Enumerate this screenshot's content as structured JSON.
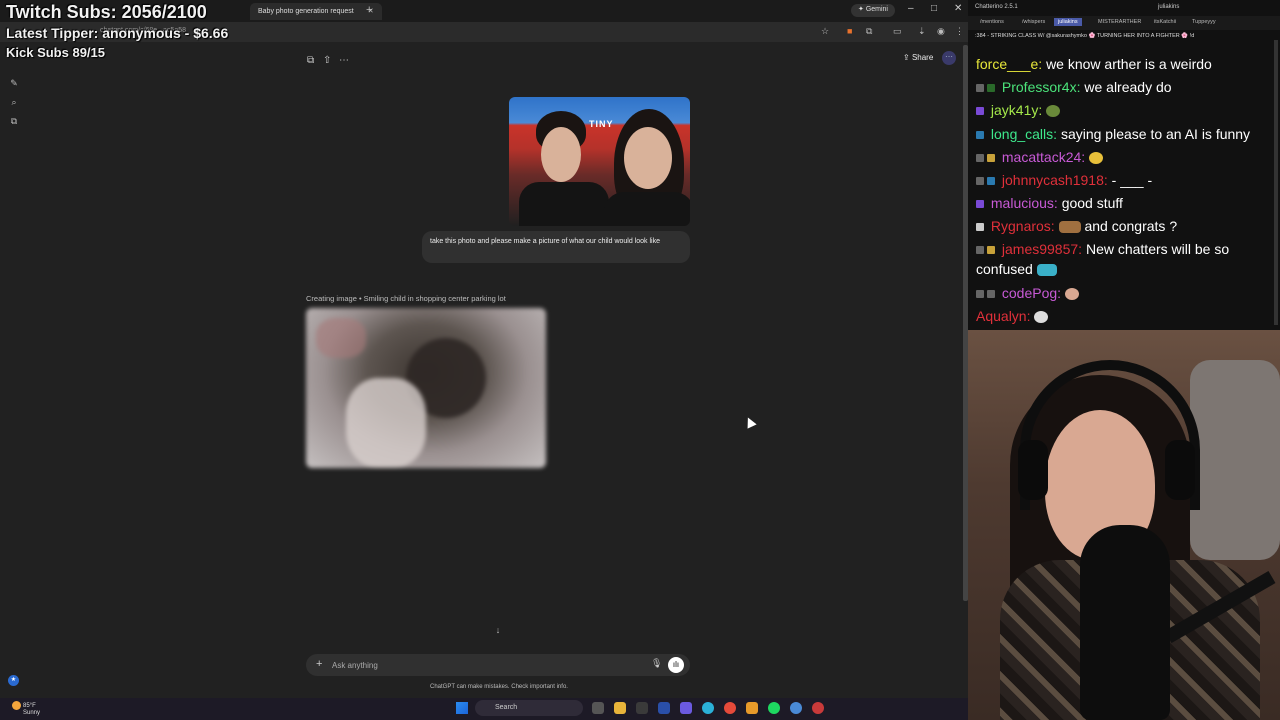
{
  "browser": {
    "tabs": [
      {
        "label": "Baby photo generation request",
        "active": true
      }
    ],
    "gemini_label": "Gemini",
    "url": "chatgpt.com/c/68e...ac5e58"
  },
  "overlay": {
    "subs": "Twitch Subs: 2056/2100",
    "tipper": "Latest Tipper: anonymous - $6.66",
    "kick": "Kick Subs 89/15"
  },
  "chatgpt": {
    "share_label": "Share",
    "photo_sign": "TINY",
    "user_message": "take this photo and please make a picture of what our child would look like",
    "creating_label": "Creating image • Smiling child in shopping center parking lot",
    "composer_placeholder": "Ask anything",
    "disclaimer": "ChatGPT can make mistakes. Check important info."
  },
  "taskbar": {
    "temperature": "85°F",
    "condition": "Sunny",
    "search_label": "Search"
  },
  "chatterino": {
    "title": "Chatterino 2.5.1",
    "user": "juliakins",
    "tabs": [
      "/mentions",
      "/whispers",
      "juliakins",
      "MISTERARTHER",
      "itsKatchii",
      "Tuppeyyy"
    ],
    "ticker": ":384 - STRIKING CLASS W/ @sakurashymko 🌸 TURNING HER INTO A FIGHTER 🌸 !d",
    "messages": [
      {
        "user": "force___e:",
        "color": "#e8e83a",
        "text": "we know arther is a weirdo"
      },
      {
        "user": "Professor4x:",
        "color": "#4be37a",
        "text": "we already do"
      },
      {
        "user": "jayk41y:",
        "color": "#a4e84a",
        "text": ""
      },
      {
        "user": "long_calls:",
        "color": "#3ee88c",
        "text": "saying please to an AI is funny"
      },
      {
        "user": "macattack24:",
        "color": "#c85ad6",
        "text": ""
      },
      {
        "user": "johnnycash1918:",
        "color": "#e0303a",
        "text": "- ___ -"
      },
      {
        "user": "malucious:",
        "color": "#c85ad6",
        "text": "good stuff"
      },
      {
        "user": "Rygnaros:",
        "color": "#e0303a",
        "text": "and congrats ?"
      },
      {
        "user": "james99857:",
        "color": "#e0303a",
        "text": "New chatters will be so"
      },
      {
        "user": "",
        "color": "#fff",
        "text": "confused"
      },
      {
        "user": "codePog:",
        "color": "#c85ad6",
        "text": ""
      },
      {
        "user": "Aqualyn:",
        "color": "#e0303a",
        "text": ""
      }
    ]
  }
}
